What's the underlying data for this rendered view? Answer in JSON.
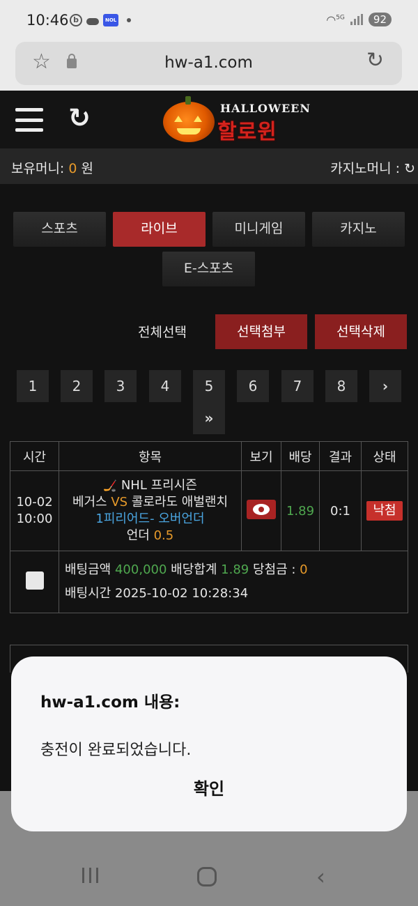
{
  "status_bar": {
    "time": "10:46",
    "left_icons": [
      "b-app-icon",
      "cloud-icon",
      "nol-icon",
      "dot-icon"
    ],
    "nol_label": "NOL",
    "right_icons": [
      "wifi-icon",
      "signal-icon",
      "battery-icon"
    ],
    "wifi_label": "5G",
    "battery": "92"
  },
  "browser": {
    "url": "hw-a1.com",
    "icons": [
      "star-icon",
      "lock-icon",
      "reload-icon"
    ]
  },
  "header": {
    "logo_en": "HALLOWEEN",
    "logo_kr": "할로윈",
    "icons": [
      "menu-icon",
      "refresh-icon",
      "pumpkin-logo"
    ]
  },
  "money": {
    "holding_label": "보유머니:",
    "holding_value": "0",
    "holding_unit": "원",
    "casino_label": "카지노머니 :",
    "colors": {
      "accent_orange": "#e79a2a",
      "accent_green": "#4fa84f",
      "accent_blue": "#4aa5e0",
      "brand_red": "#a82a2a"
    }
  },
  "categories": [
    {
      "label": "스포츠",
      "active": false
    },
    {
      "label": "라이브",
      "active": true
    },
    {
      "label": "미니게임",
      "active": false
    },
    {
      "label": "카지노",
      "active": false
    },
    {
      "label": "E-스포츠",
      "active": false
    }
  ],
  "actions": {
    "select_all": "전체선택",
    "attach_selected": "선택첨부",
    "delete_selected": "선택삭제"
  },
  "pagination": {
    "pages": [
      "1",
      "2",
      "3",
      "4",
      "5",
      "6",
      "7",
      "8"
    ],
    "next": "›",
    "last": "»"
  },
  "table": {
    "headers": [
      "시간",
      "항목",
      "보기",
      "배당",
      "결과",
      "상태"
    ],
    "rows": [
      {
        "date": "10-02",
        "time": "10:00",
        "league": "NHL 프리시즌",
        "home": "베거스",
        "vs": "VS",
        "away": "콜로라도 애벌랜치",
        "market": "1피리어드- 오버언더",
        "pick": "언더",
        "line": "0.5",
        "odds": "1.89",
        "result": "0:1",
        "status": "낙첨",
        "bet_amount_label": "배팅금액",
        "bet_amount": "400,000",
        "odds_total_label": "배당합계",
        "odds_total": "1.89",
        "win_label": "당첨금 :",
        "win_amount": "0",
        "bet_time_label": "배팅시간",
        "bet_time": "2025-10-02 10:28:34"
      }
    ]
  },
  "dialog": {
    "title": "hw-a1.com 내용:",
    "message": "충전이 완료되었습니다.",
    "ok_label": "확인"
  },
  "nav": {
    "icons": [
      "recents-icon",
      "home-icon",
      "back-icon"
    ]
  }
}
